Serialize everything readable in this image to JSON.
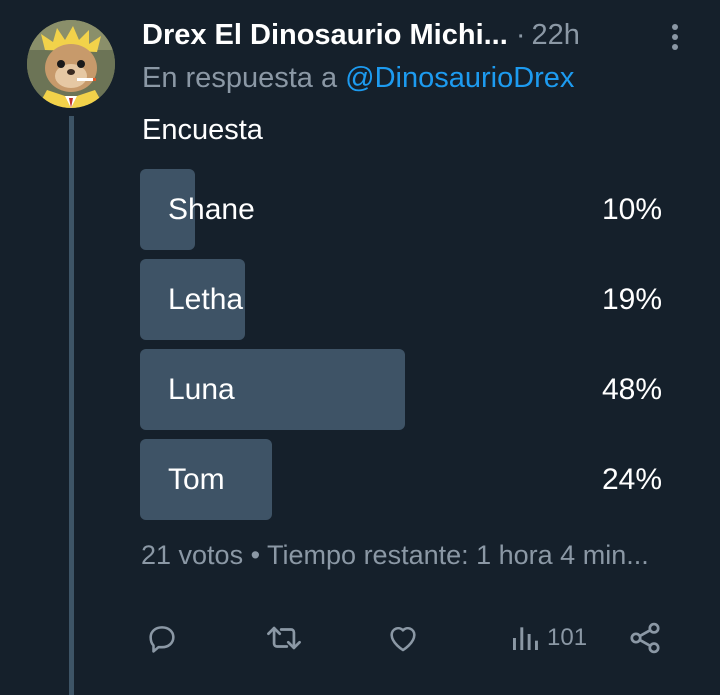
{
  "post": {
    "author": "Drex El Dinosaurio Michi...",
    "separator": "·",
    "time": "22h",
    "reply_prefix": "En respuesta a",
    "reply_handle": "@DinosaurioDrex"
  },
  "poll": {
    "title": "Encuesta",
    "options": [
      {
        "label": "Shane",
        "percent_text": "10%",
        "percent": 10
      },
      {
        "label": "Letha",
        "percent_text": "19%",
        "percent": 19
      },
      {
        "label": "Luna",
        "percent_text": "48%",
        "percent": 48
      },
      {
        "label": "Tom",
        "percent_text": "24%",
        "percent": 24
      }
    ],
    "footer": "21 votos • Tiempo restante: 1 hora 4 min..."
  },
  "actions": {
    "reply_icon": "reply-icon",
    "retweet_icon": "retweet-icon",
    "like_icon": "heart-icon",
    "views_icon": "views-icon",
    "views_count": "101",
    "share_icon": "share-icon"
  },
  "colors": {
    "background": "#15202b",
    "poll_bar": "#3e5366",
    "muted_text": "#8b98a5",
    "link": "#1d9bf0"
  }
}
